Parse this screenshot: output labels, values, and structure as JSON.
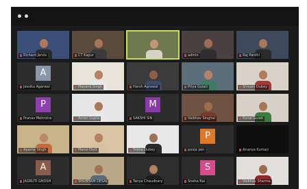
{
  "participants": [
    {
      "name": "Richard Jervis",
      "kind": "video",
      "bg": "#3a4f78",
      "skin": "#b07a5a",
      "shirt": "#2b2b2b"
    },
    {
      "name": "CT Kapur",
      "kind": "video",
      "bg": "#5a4a3c",
      "skin": "#a8765a",
      "shirt": "#3a3a3a"
    },
    {
      "name": "",
      "kind": "video",
      "bg": "#6e7a4e",
      "skin": "#c29574",
      "shirt": "#d7d3c8",
      "active": true
    },
    {
      "name": "admin",
      "kind": "video",
      "bg": "#4a4040",
      "skin": "#9c6d55",
      "shirt": "#2d2d2d"
    },
    {
      "name": "Raj Pardhi",
      "kind": "video",
      "bg": "#3d4a5c",
      "skin": "#a9785c",
      "shirt": "#2a2a2a"
    },
    {
      "name": "Jessika Agarwal",
      "kind": "avatar",
      "letter": "A",
      "color": "#8a97a8"
    },
    {
      "name": "Mayank Singh",
      "kind": "video",
      "bg": "#e9e4da",
      "skin": "#b48364",
      "shirt": "#e8e8e8"
    },
    {
      "name": "Harsh Agrawal",
      "kind": "video",
      "bg": "#3b3b3b",
      "skin": "#8c5e44",
      "shirt": "#3a4a6a"
    },
    {
      "name": "Priya Gulati",
      "kind": "video",
      "bg": "#5b6e7a",
      "skin": "#b88466",
      "shirt": "#3f7a63"
    },
    {
      "name": "Shivani Dubey",
      "kind": "video",
      "bg": "#d8d2c8",
      "skin": "#b07c5c",
      "shirt": "#a33a3a"
    },
    {
      "name": "Pranav Mehrotra",
      "kind": "avatar",
      "letter": "P",
      "color": "#8e3fae"
    },
    {
      "name": "Aman Gupta",
      "kind": "video",
      "bg": "#e6e6e6",
      "skin": "#a87858",
      "shirt": "#e9e9e9"
    },
    {
      "name": "SAKSHI SIN",
      "kind": "avatar",
      "letter": "M",
      "color": "#8a3aa6"
    },
    {
      "name": "Vaibhav Singhal",
      "kind": "video",
      "bg": "#6e5242",
      "skin": "#a06c4e",
      "shirt": "#7a3a2a"
    },
    {
      "name": "Kunal Gulati",
      "kind": "video",
      "bg": "#d6d0c6",
      "skin": "#a77656",
      "shirt": "#3f7a3f"
    },
    {
      "name": "Aparna Singh",
      "kind": "video",
      "bg": "#c9b48a",
      "skin": "#b98a64",
      "shirt": "#c96a3a"
    },
    {
      "name": "Mansi Dixit",
      "kind": "video",
      "bg": "#d9c4a4",
      "skin": "#b4825e",
      "shirt": "#d8c0a0"
    },
    {
      "name": "Trisha Dubey",
      "kind": "video",
      "bg": "#e8e8e8",
      "skin": "#9a7058",
      "shirt": "#2a2a2a"
    },
    {
      "name": "pooja jain",
      "kind": "avatar",
      "letter": "P",
      "color": "#e0782a"
    },
    {
      "name": "Ananya Kumari",
      "kind": "dark"
    },
    {
      "name": "JAGRUTI GHOSH",
      "kind": "avatar",
      "letter": "A",
      "color": "#8a5a4a"
    },
    {
      "name": "SHUBHAM DESAI",
      "kind": "video",
      "bg": "#b8a888",
      "skin": "#a27456",
      "shirt": "#5a6a7a"
    },
    {
      "name": "Tanya Chaudhary",
      "kind": "video",
      "bg": "#2e2e2e",
      "skin": "#b08060",
      "shirt": "#1e1e1e"
    },
    {
      "name": "Sneha Rai",
      "kind": "avatar",
      "letter": "S",
      "color": "#d84a8a"
    },
    {
      "name": "Vaibhav Sharma",
      "kind": "video",
      "bg": "#e2e0dc",
      "skin": "#a06a50",
      "shirt": "#8a2a2a"
    }
  ]
}
